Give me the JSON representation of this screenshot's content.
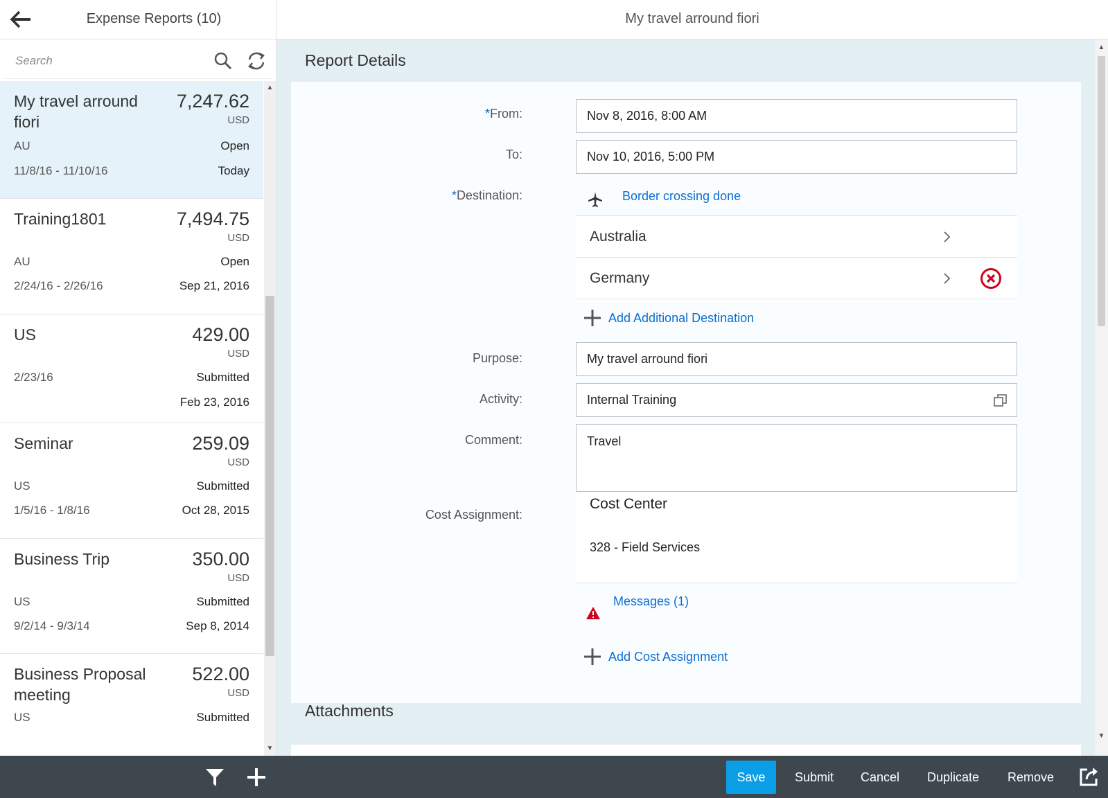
{
  "master": {
    "title": "Expense Reports (10)",
    "search_placeholder": "Search",
    "items": [
      {
        "title": "My travel arround fiori",
        "amount": "7,247.62",
        "currency": "USD",
        "attr1": "AU",
        "status": "Open",
        "attr2": "11/8/16 - 11/10/16",
        "date": "Today"
      },
      {
        "title": "Training1801",
        "amount": "7,494.75",
        "currency": "USD",
        "attr1": "AU",
        "status": "Open",
        "attr2": "2/24/16 - 2/26/16",
        "date": "Sep 21, 2016"
      },
      {
        "title": "US",
        "amount": "429.00",
        "currency": "USD",
        "attr1": "2/23/16",
        "status": "Submitted",
        "attr2": "",
        "date": "Feb 23, 2016"
      },
      {
        "title": "Seminar",
        "amount": "259.09",
        "currency": "USD",
        "attr1": "US",
        "status": "Submitted",
        "attr2": "1/5/16 - 1/8/16",
        "date": "Oct 28, 2015"
      },
      {
        "title": "Business Trip",
        "amount": "350.00",
        "currency": "USD",
        "attr1": "US",
        "status": "Submitted",
        "attr2": "9/2/14 - 9/3/14",
        "date": "Sep 8, 2014"
      },
      {
        "title": "Business Proposal meeting",
        "amount": "522.00",
        "currency": "USD",
        "attr1": "US",
        "status": "Submitted",
        "attr2": "",
        "date": ""
      }
    ]
  },
  "detail": {
    "title": "My travel arround fiori",
    "section_report": "Report Details",
    "section_attachments": "Attachments",
    "required_marker": "*",
    "from_label": "From:",
    "from_value": "Nov 8, 2016, 8:00 AM",
    "to_label": "To:",
    "to_value": "Nov 10, 2016, 5:00 PM",
    "destination_label": "Destination:",
    "border_crossing_link": "Border crossing done",
    "destinations": [
      "Australia",
      "Germany"
    ],
    "add_destination": "Add Additional Destination",
    "purpose_label": "Purpose:",
    "purpose_value": "My travel arround fiori",
    "activity_label": "Activity:",
    "activity_value": "Internal Training",
    "comment_label": "Comment:",
    "comment_value": "Travel",
    "cost_label": "Cost Assignment:",
    "cost_type": "Cost Center",
    "cost_value": "328 - Field Services",
    "messages_link": "Messages (1)",
    "add_cost": "Add Cost Assignment"
  },
  "footer": {
    "save": "Save",
    "submit": "Submit",
    "cancel": "Cancel",
    "duplicate": "Duplicate",
    "remove": "Remove"
  },
  "colors": {
    "accent": "#0a6ed1",
    "primary_button": "#0a9ee6",
    "footer_bg": "#3f474e",
    "selected_item": "#e5f2fa",
    "error": "#d0021b"
  },
  "icons": [
    "back-arrow-icon",
    "search-icon",
    "refresh-icon",
    "airplane-icon",
    "chevron-right-icon",
    "delete-circle-icon",
    "add-icon",
    "value-help-icon",
    "warning-icon",
    "filter-icon",
    "share-icon"
  ]
}
